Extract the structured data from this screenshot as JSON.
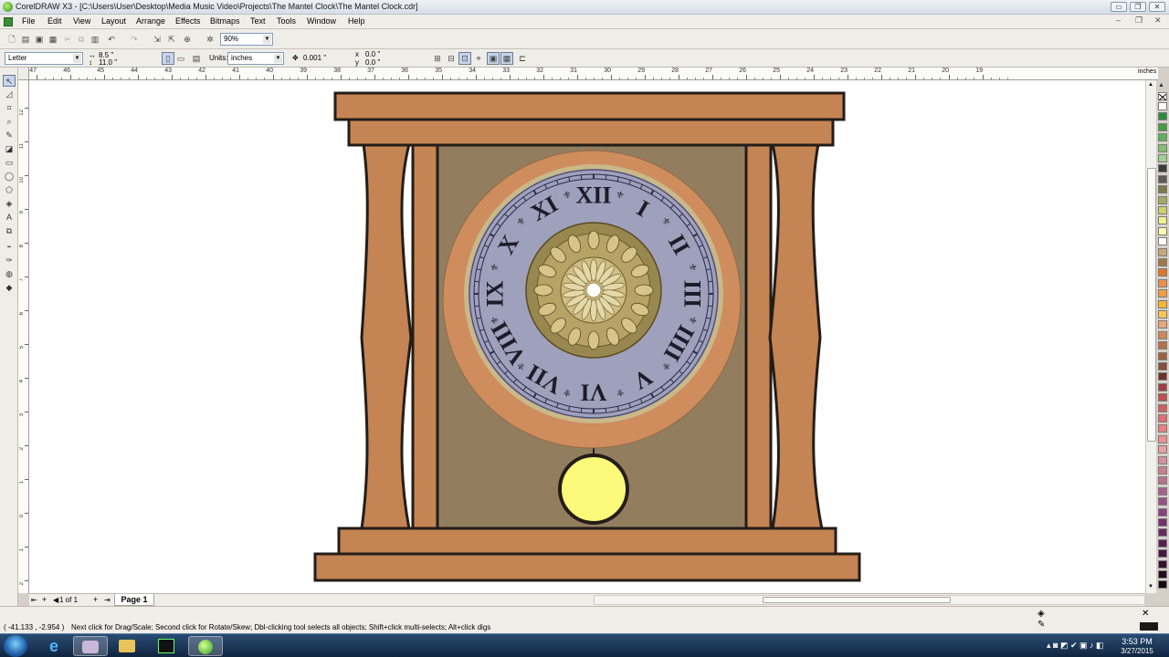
{
  "window": {
    "title": "CorelDRAW X3 - [C:\\Users\\User\\Desktop\\Media Music Video\\Projects\\The Mantel Clock\\The Mantel Clock.cdr]",
    "app_icon": "coreldraw-icon",
    "minimize_glyph": "▭",
    "restore_glyph": "❐",
    "close_glyph": "✕"
  },
  "menu": {
    "items": [
      "File",
      "Edit",
      "View",
      "Layout",
      "Arrange",
      "Effects",
      "Bitmaps",
      "Text",
      "Tools",
      "Window",
      "Help"
    ]
  },
  "standard_toolbar": {
    "zoom_value": "90%"
  },
  "property_bar": {
    "page_size": "Letter",
    "page_width": "8.5 \"",
    "page_height": "11.0 \"",
    "units_label": "Units:",
    "units_value": "inches",
    "nudge_value": "0.001 \"",
    "duplicate_x": "0.0 \"",
    "duplicate_y": "0.0 \""
  },
  "rulers": {
    "h_ticks": [
      "47",
      "46",
      "45",
      "44",
      "43",
      "42",
      "41",
      "40",
      "39",
      "38",
      "37",
      "36",
      "35",
      "34",
      "33",
      "32",
      "31",
      "30",
      "29",
      "28",
      "27",
      "26",
      "25",
      "24",
      "23",
      "22",
      "21",
      "20",
      "19"
    ],
    "h_unit": "inches",
    "v_ticks": [
      "12",
      "11",
      "10",
      "9",
      "8",
      "7",
      "6",
      "5",
      "4",
      "3",
      "2",
      "1",
      "0",
      "1",
      "2"
    ],
    "v_unit": "inches"
  },
  "document": {
    "page_count": "1 of 1",
    "page_tab": "Page 1"
  },
  "clock": {
    "colors": {
      "wood": "#c48454",
      "outline": "#231d18",
      "back_panel": "#937d5f",
      "ring_copper": "#cf8c5c",
      "dial_face": "#9fa0bb",
      "medallion": "#988850",
      "medallion_light": "#d0bd83",
      "pendulum": "#fdf97a"
    },
    "numerals": [
      "XII",
      "I",
      "II",
      "III",
      "IIII",
      "V",
      "VI",
      "VII",
      "VIII",
      "IX",
      "X",
      "XI"
    ]
  },
  "status": {
    "coordinates": "( -41.133 , -2.954 )",
    "hint": "Next click for Drag/Scale; Second click for Rotate/Skew; Dbl-clicking tool selects all objects; Shift+click multi-selects; Alt+click digs"
  },
  "palette": {
    "colors": [
      "#ffffff",
      "#2e8b3e",
      "#40a040",
      "#5fb05a",
      "#80c070",
      "#a0d090",
      "#3c3c3c",
      "#5a5a5a",
      "#7a7a4a",
      "#a8a860",
      "#d0d070",
      "#f0f090",
      "#fffdb0",
      "#ffffff",
      "#c8a878",
      "#a07848",
      "#e07828",
      "#f09048",
      "#f4a040",
      "#f8b830",
      "#fcc850",
      "#e8a878",
      "#d08858",
      "#b87048",
      "#a06040",
      "#885038",
      "#703028",
      "#a04040",
      "#c05050",
      "#d06060",
      "#e07070",
      "#e88080",
      "#f09090",
      "#e8a0a0",
      "#d890a0",
      "#c88090",
      "#b87090",
      "#a86090",
      "#985088",
      "#884080",
      "#783070",
      "#682860",
      "#582050",
      "#481840",
      "#381030",
      "#280820",
      "#180810"
    ]
  },
  "taskbar": {
    "time": "3:53 PM",
    "date": "3/27/2015",
    "start_icon": "windows-orb-icon"
  }
}
